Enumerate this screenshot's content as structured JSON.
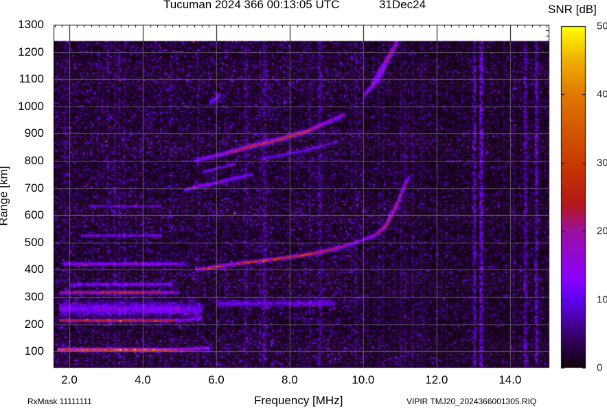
{
  "header": {
    "title": "Tucuman 2024 366 00:13:05 UTC",
    "date": "31Dec24"
  },
  "footer": {
    "rxmask": "RxMask 11111111",
    "filename": "VIPIR  TMJ20_2024366001305.RIQ"
  },
  "chart_data": {
    "type": "heatmap",
    "title": "Tucuman 2024 366 00:13:05 UTC",
    "xlabel": "Frequency [MHz]",
    "ylabel": "Range [km]",
    "colorbar_label": "SNR [dB]",
    "xlim": [
      1.57,
      15.07
    ],
    "ylim": [
      40,
      1300
    ],
    "data_max_range": 1240,
    "clim": [
      0,
      50
    ],
    "grid": true,
    "xticks": [
      "2.0",
      "4.0",
      "6.0",
      "8.0",
      "10.0",
      "12.0",
      "14.0"
    ],
    "xtick_values": [
      2,
      4,
      6,
      8,
      10,
      12,
      14
    ],
    "yticks": [
      "100",
      "200",
      "300",
      "400",
      "500",
      "600",
      "700",
      "800",
      "900",
      "1000",
      "1100",
      "1200",
      "1300"
    ],
    "ytick_values": [
      100,
      200,
      300,
      400,
      500,
      600,
      700,
      800,
      900,
      1000,
      1100,
      1200,
      1300
    ],
    "cbticks": [
      "0",
      "10",
      "20",
      "30",
      "40",
      "50"
    ],
    "cbtick_values": [
      0,
      10,
      20,
      30,
      40,
      50
    ],
    "colormap": [
      [
        0,
        "#100008"
      ],
      [
        5,
        "#3a0070"
      ],
      [
        10,
        "#6000f0"
      ],
      [
        13,
        "#8a00ff"
      ],
      [
        20,
        "#9a10a0"
      ],
      [
        24,
        "#b41818"
      ],
      [
        30,
        "#c83a00"
      ],
      [
        40,
        "#e07800"
      ],
      [
        45,
        "#f0b000"
      ],
      [
        50,
        "#ffff00"
      ]
    ],
    "traces": [
      {
        "name": "E",
        "width": 6,
        "points": [
          [
            1.65,
            105,
            30
          ],
          [
            3.0,
            105,
            34
          ],
          [
            4.5,
            104,
            32
          ],
          [
            5.0,
            105,
            22
          ],
          [
            5.4,
            108,
            15
          ],
          [
            5.8,
            112,
            13
          ]
        ]
      },
      {
        "name": "2E",
        "width": 5,
        "points": [
          [
            1.7,
            212,
            24
          ],
          [
            3.0,
            212,
            28
          ],
          [
            4.6,
            212,
            27
          ],
          [
            5.0,
            213,
            14
          ],
          [
            5.6,
            220,
            11
          ]
        ]
      },
      {
        "name": "2E-diffuse",
        "width": 22,
        "points": [
          [
            1.7,
            255,
            10
          ],
          [
            4.8,
            255,
            11
          ],
          [
            5.6,
            250,
            8
          ]
        ]
      },
      {
        "name": "3E",
        "width": 5,
        "points": [
          [
            1.7,
            315,
            18
          ],
          [
            3.5,
            315,
            23
          ],
          [
            4.5,
            315,
            20
          ],
          [
            5.0,
            315,
            10
          ]
        ]
      },
      {
        "name": "3E-upper",
        "width": 6,
        "points": [
          [
            2.0,
            345,
            10
          ],
          [
            4.8,
            345,
            11
          ]
        ]
      },
      {
        "name": "4E",
        "width": 6,
        "points": [
          [
            1.8,
            420,
            13
          ],
          [
            3.5,
            420,
            14
          ],
          [
            4.8,
            420,
            14
          ],
          [
            5.2,
            420,
            6
          ]
        ]
      },
      {
        "name": "5E",
        "width": 5,
        "points": [
          [
            2.3,
            525,
            9
          ],
          [
            4.5,
            525,
            10
          ]
        ]
      },
      {
        "name": "6E",
        "width": 4,
        "points": [
          [
            2.5,
            632,
            8
          ],
          [
            4.5,
            632,
            8
          ]
        ]
      },
      {
        "name": "F-diffuse",
        "width": 10,
        "points": [
          [
            6.0,
            275,
            8
          ],
          [
            9.2,
            275,
            8
          ]
        ]
      },
      {
        "name": "F",
        "width": 5,
        "points": [
          [
            5.4,
            400,
            15
          ],
          [
            5.7,
            402,
            30
          ],
          [
            6.2,
            415,
            18
          ],
          [
            7.0,
            428,
            28
          ],
          [
            8.0,
            445,
            28
          ],
          [
            8.6,
            458,
            26
          ],
          [
            9.2,
            475,
            22
          ],
          [
            9.7,
            495,
            14
          ],
          [
            10.0,
            510,
            14
          ],
          [
            10.3,
            525,
            20
          ],
          [
            10.6,
            560,
            25
          ],
          [
            10.9,
            640,
            22
          ],
          [
            11.15,
            720,
            15
          ],
          [
            11.25,
            740,
            10
          ]
        ]
      },
      {
        "name": "2F-low",
        "width": 5,
        "points": [
          [
            5.1,
            690,
            12
          ],
          [
            5.5,
            705,
            15
          ],
          [
            6.0,
            718,
            14
          ],
          [
            6.5,
            735,
            12
          ],
          [
            7.0,
            750,
            10
          ]
        ]
      },
      {
        "name": "2F-low-upper",
        "width": 4,
        "points": [
          [
            5.6,
            758,
            10
          ],
          [
            6.5,
            788,
            10
          ]
        ]
      },
      {
        "name": "2F",
        "width": 6,
        "points": [
          [
            5.4,
            800,
            10
          ],
          [
            6.2,
            825,
            14
          ],
          [
            7.0,
            855,
            28
          ],
          [
            7.5,
            870,
            22
          ],
          [
            8.0,
            890,
            28
          ],
          [
            8.5,
            910,
            24
          ],
          [
            9.0,
            940,
            15
          ],
          [
            9.5,
            970,
            10
          ]
        ]
      },
      {
        "name": "2F-echo",
        "width": 5,
        "points": [
          [
            7.2,
            805,
            8
          ],
          [
            8.5,
            840,
            9
          ],
          [
            9.3,
            870,
            6
          ]
        ]
      },
      {
        "name": "3F-a",
        "width": 6,
        "points": [
          [
            10.0,
            1040,
            12
          ],
          [
            10.4,
            1100,
            14
          ],
          [
            10.7,
            1180,
            12
          ],
          [
            10.9,
            1240,
            10
          ]
        ]
      },
      {
        "name": "3F-b",
        "width": 5,
        "points": [
          [
            10.2,
            1080,
            10
          ],
          [
            10.6,
            1170,
            12
          ],
          [
            10.95,
            1240,
            10
          ]
        ]
      },
      {
        "name": "blob",
        "width": 8,
        "points": [
          [
            5.8,
            1010,
            9
          ],
          [
            6.1,
            1040,
            9
          ]
        ]
      }
    ],
    "interference_columns": [
      [
        13.2,
        9
      ],
      [
        14.4,
        6
      ],
      [
        14.7,
        7
      ],
      [
        13.0,
        4
      ],
      [
        8.8,
        4
      ],
      [
        7.3,
        4
      ]
    ]
  }
}
